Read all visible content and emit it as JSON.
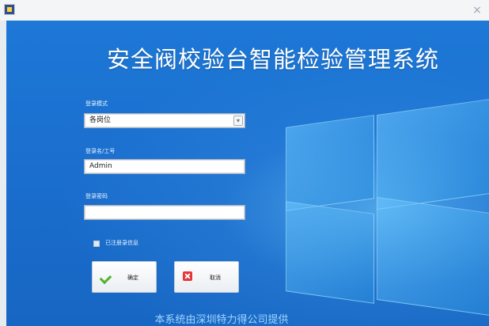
{
  "window": {
    "close_glyph": "×"
  },
  "title": "安全阀校验台智能检验管理系统",
  "form": {
    "mode_label": "登录模式",
    "mode_value": "各岗位",
    "user_label": "登录名/工号",
    "user_value": "Admin",
    "password_label": "登录密码",
    "password_value": "",
    "remember_label": "已注册录信息"
  },
  "buttons": {
    "ok_label": "确定",
    "cancel_label": "取消"
  },
  "footer": "本系统由深圳特力得公司提供",
  "colors": {
    "accent": "#1b6fcf",
    "ok": "#4fb42b",
    "cancel": "#e5373a"
  }
}
